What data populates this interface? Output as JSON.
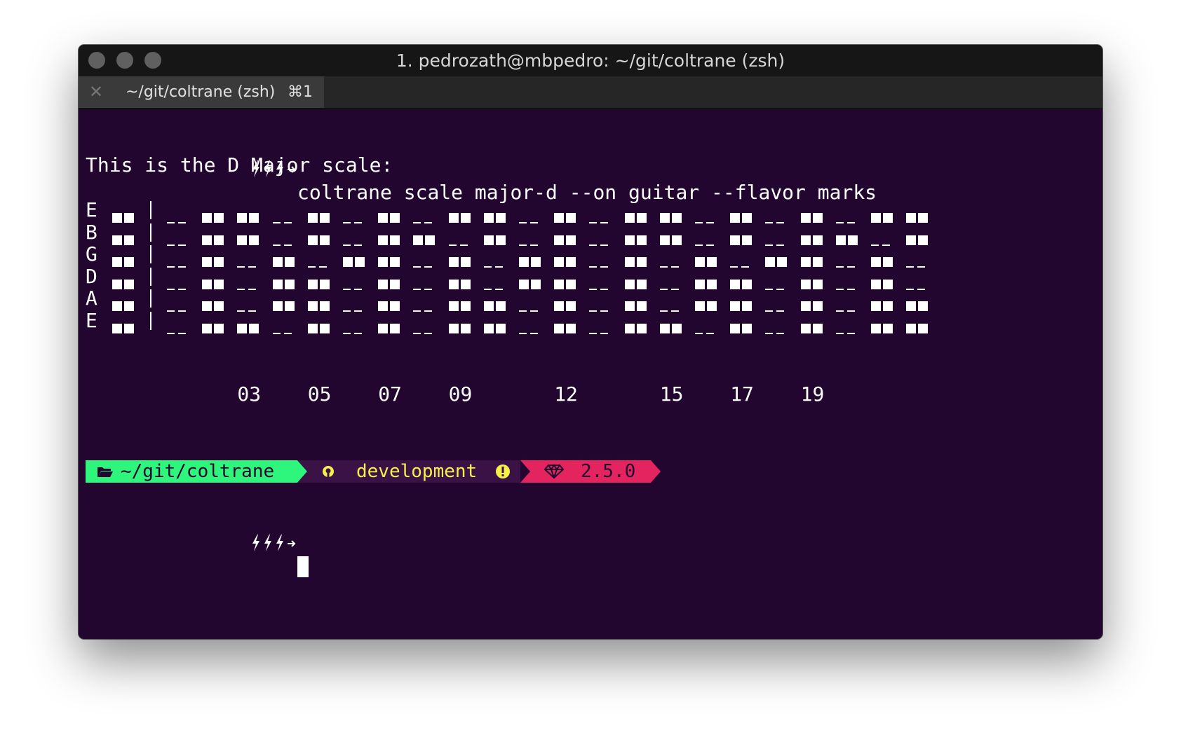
{
  "window": {
    "title": "1. pedrozath@mbpedro: ~/git/coltrane (zsh)",
    "tab": {
      "label": "~/git/coltrane (zsh)",
      "shortcut": "⌘1",
      "close_icon": "close-icon"
    }
  },
  "terminal": {
    "command": "coltrane scale major-d --on guitar --flavor marks",
    "heading": "This is the D Major scale:",
    "strings": [
      {
        "name": "E",
        "frets": [
          0,
          1,
          1,
          0,
          1,
          0,
          1,
          0,
          1,
          1,
          0,
          1,
          0,
          1,
          1,
          0,
          1,
          0,
          1,
          0,
          1,
          1
        ]
      },
      {
        "name": "B",
        "frets": [
          0,
          1,
          1,
          0,
          1,
          0,
          1,
          1,
          0,
          1,
          0,
          1,
          0,
          1,
          1,
          0,
          1,
          0,
          1,
          1,
          0,
          1
        ]
      },
      {
        "name": "G",
        "frets": [
          0,
          1,
          0,
          1,
          0,
          1,
          1,
          0,
          1,
          0,
          1,
          1,
          0,
          1,
          0,
          1,
          0,
          1,
          1,
          0,
          1,
          0
        ]
      },
      {
        "name": "D",
        "frets": [
          0,
          1,
          0,
          1,
          1,
          0,
          1,
          0,
          1,
          0,
          1,
          1,
          0,
          1,
          0,
          1,
          1,
          0,
          1,
          0,
          1,
          0
        ]
      },
      {
        "name": "A",
        "frets": [
          0,
          1,
          0,
          1,
          1,
          0,
          1,
          0,
          1,
          1,
          0,
          1,
          0,
          1,
          0,
          1,
          1,
          0,
          1,
          0,
          1,
          1
        ]
      },
      {
        "name": "E",
        "frets": [
          0,
          1,
          1,
          0,
          1,
          0,
          1,
          0,
          1,
          1,
          0,
          1,
          0,
          1,
          1,
          0,
          1,
          0,
          1,
          0,
          1,
          1
        ]
      }
    ],
    "fret_markers": [
      {
        "label": "03",
        "fret": 3
      },
      {
        "label": "05",
        "fret": 5
      },
      {
        "label": "07",
        "fret": 7
      },
      {
        "label": "09",
        "fret": 9
      },
      {
        "label": "12",
        "fret": 12
      },
      {
        "label": "15",
        "fret": 15
      },
      {
        "label": "17",
        "fret": 17
      },
      {
        "label": "19",
        "fret": 19
      }
    ],
    "status": {
      "path": "~/git/coltrane",
      "branch": "development",
      "ruby_version": "2.5.0",
      "path_color": "#2ef57b",
      "git_color": "#f6f04a",
      "ruby_color": "#e3245e"
    }
  }
}
